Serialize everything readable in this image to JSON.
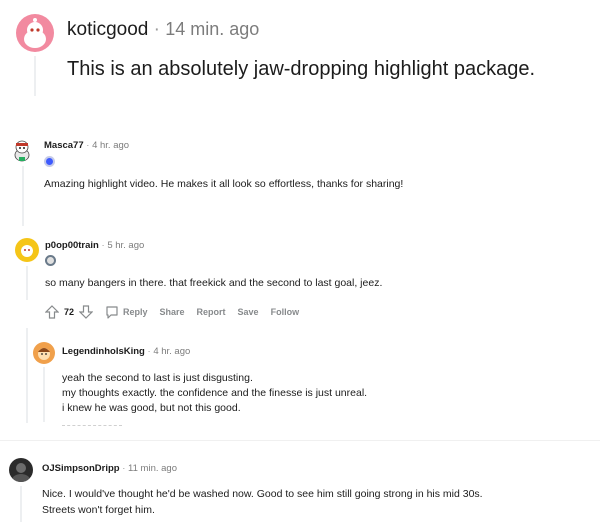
{
  "comments": [
    {
      "author": "koticgood",
      "separator": "·",
      "time": "14 min. ago",
      "body": "This is an absolutely jaw-dropping highlight package."
    },
    {
      "author": "Masca77",
      "separator": "·",
      "time": "4 hr. ago",
      "body": "Amazing highlight video. He makes it all look so effortless, thanks for sharing!"
    },
    {
      "author": "p0op00train",
      "separator": "·",
      "time": "5 hr. ago",
      "body": "so many bangers in there. that freekick and the second to last goal, jeez.",
      "votes": "72",
      "actions": {
        "reply": "Reply",
        "share": "Share",
        "report": "Report",
        "save": "Save",
        "follow": "Follow"
      }
    },
    {
      "author": "LegendinhoIsKing",
      "separator": "·",
      "time": "4 hr. ago",
      "lines": [
        "yeah the second to last is just disgusting.",
        "my thoughts exactly. the confidence and the finesse is just unreal.",
        "i knew he was good, but not this good."
      ]
    },
    {
      "author": "OJSimpsonDripp",
      "separator": "·",
      "time": "11 min. ago",
      "lines": [
        "Nice. I would've thought he'd be washed now. Good to see him still going strong in his mid 30s.",
        "Streets won't forget him."
      ]
    }
  ],
  "colors": {
    "avatar_pink": "#f28aa0",
    "avatar_yellow": "#f5c518",
    "avatar_orange": "#f0a04b",
    "flair_blue": "#3d5afe",
    "thread_line": "#edeff1"
  }
}
